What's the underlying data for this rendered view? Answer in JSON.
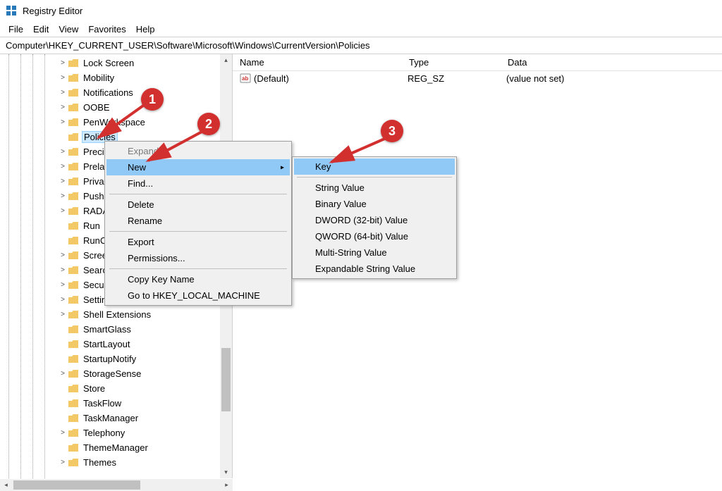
{
  "window": {
    "title": "Registry Editor"
  },
  "menu": {
    "items": [
      "File",
      "Edit",
      "View",
      "Favorites",
      "Help"
    ]
  },
  "address": "Computer\\HKEY_CURRENT_USER\\Software\\Microsoft\\Windows\\CurrentVersion\\Policies",
  "tree": [
    {
      "label": "Lock Screen",
      "indent": 82,
      "exp": ">"
    },
    {
      "label": "Mobility",
      "indent": 82,
      "exp": ">"
    },
    {
      "label": "Notifications",
      "indent": 82,
      "exp": ">"
    },
    {
      "label": "OOBE",
      "indent": 82,
      "exp": ">"
    },
    {
      "label": "PenWorkspace",
      "indent": 82,
      "exp": ">"
    },
    {
      "label": "Policies",
      "indent": 82,
      "exp": "",
      "selected": true
    },
    {
      "label": "Preci",
      "indent": 82,
      "exp": ">"
    },
    {
      "label": "Prela",
      "indent": 82,
      "exp": ">"
    },
    {
      "label": "Priva",
      "indent": 82,
      "exp": ">"
    },
    {
      "label": "PushI",
      "indent": 82,
      "exp": ">"
    },
    {
      "label": "RADA",
      "indent": 82,
      "exp": ">"
    },
    {
      "label": "Run",
      "indent": 82,
      "exp": ""
    },
    {
      "label": "RunC",
      "indent": 82,
      "exp": ""
    },
    {
      "label": "Scree",
      "indent": 82,
      "exp": ">"
    },
    {
      "label": "Searc",
      "indent": 82,
      "exp": ">"
    },
    {
      "label": "Secur",
      "indent": 82,
      "exp": ">"
    },
    {
      "label": "SettingSync",
      "indent": 82,
      "exp": ">"
    },
    {
      "label": "Shell Extensions",
      "indent": 82,
      "exp": ">"
    },
    {
      "label": "SmartGlass",
      "indent": 82,
      "exp": ""
    },
    {
      "label": "StartLayout",
      "indent": 82,
      "exp": ""
    },
    {
      "label": "StartupNotify",
      "indent": 82,
      "exp": ""
    },
    {
      "label": "StorageSense",
      "indent": 82,
      "exp": ">"
    },
    {
      "label": "Store",
      "indent": 82,
      "exp": ""
    },
    {
      "label": "TaskFlow",
      "indent": 82,
      "exp": ""
    },
    {
      "label": "TaskManager",
      "indent": 82,
      "exp": ""
    },
    {
      "label": "Telephony",
      "indent": 82,
      "exp": ">"
    },
    {
      "label": "ThemeManager",
      "indent": 82,
      "exp": ""
    },
    {
      "label": "Themes",
      "indent": 82,
      "exp": ">"
    }
  ],
  "list": {
    "headers": {
      "name": "Name",
      "type": "Type",
      "data": "Data"
    },
    "rows": [
      {
        "name": "(Default)",
        "type": "REG_SZ",
        "data": "(value not set)"
      }
    ]
  },
  "ctx1": {
    "expand": "Expand",
    "new": "New",
    "find": "Find...",
    "delete": "Delete",
    "rename": "Rename",
    "export": "Export",
    "permissions": "Permissions...",
    "copy": "Copy Key Name",
    "goto": "Go to HKEY_LOCAL_MACHINE"
  },
  "ctx2": {
    "key": "Key",
    "string": "String Value",
    "binary": "Binary Value",
    "dword": "DWORD (32-bit) Value",
    "qword": "QWORD (64-bit) Value",
    "multi": "Multi-String Value",
    "expand": "Expandable String Value"
  },
  "badges": {
    "b1": "1",
    "b2": "2",
    "b3": "3"
  }
}
